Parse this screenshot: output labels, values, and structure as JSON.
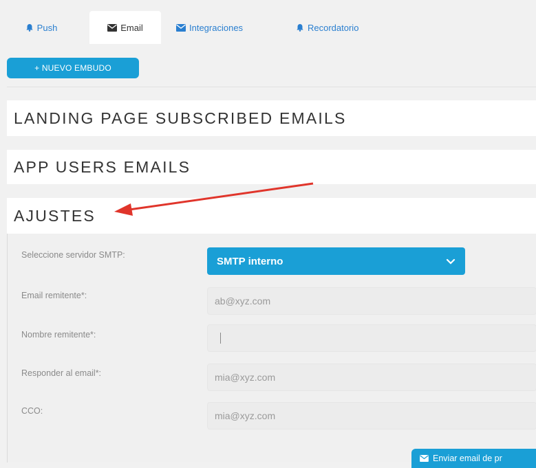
{
  "tabs": [
    {
      "label": "Push",
      "icon": "bell-icon",
      "active": false
    },
    {
      "label": "Email",
      "icon": "envelope-icon",
      "active": true
    },
    {
      "label": "Integraciones",
      "icon": "envelope-icon",
      "active": false
    },
    {
      "label": "Recordatorio",
      "icon": "bell-icon",
      "active": false
    }
  ],
  "toolbar": {
    "new_funnel_label": "+ NUEVO EMBUDO"
  },
  "sections": {
    "landing": "LANDING PAGE SUBSCRIBED EMAILS",
    "app_users": "APP USERS EMAILS",
    "settings": "AJUSTES"
  },
  "settings": {
    "smtp_label": "Seleccione servidor SMTP:",
    "smtp_value": "SMTP interno",
    "sender_email_label": "Email remitente*:",
    "sender_email_value": "ab@xyz.com",
    "sender_name_label": "Nombre remitente*:",
    "sender_name_value": "",
    "reply_to_label": "Responder al email*:",
    "reply_to_value": "mia@xyz.com",
    "bcc_label": "CCO:",
    "bcc_value": "mia@xyz.com",
    "send_test_label": "Enviar email de pr"
  },
  "colors": {
    "accent": "#1a9fd6",
    "link": "#2a7fd0",
    "arrow": "#e0352b"
  }
}
